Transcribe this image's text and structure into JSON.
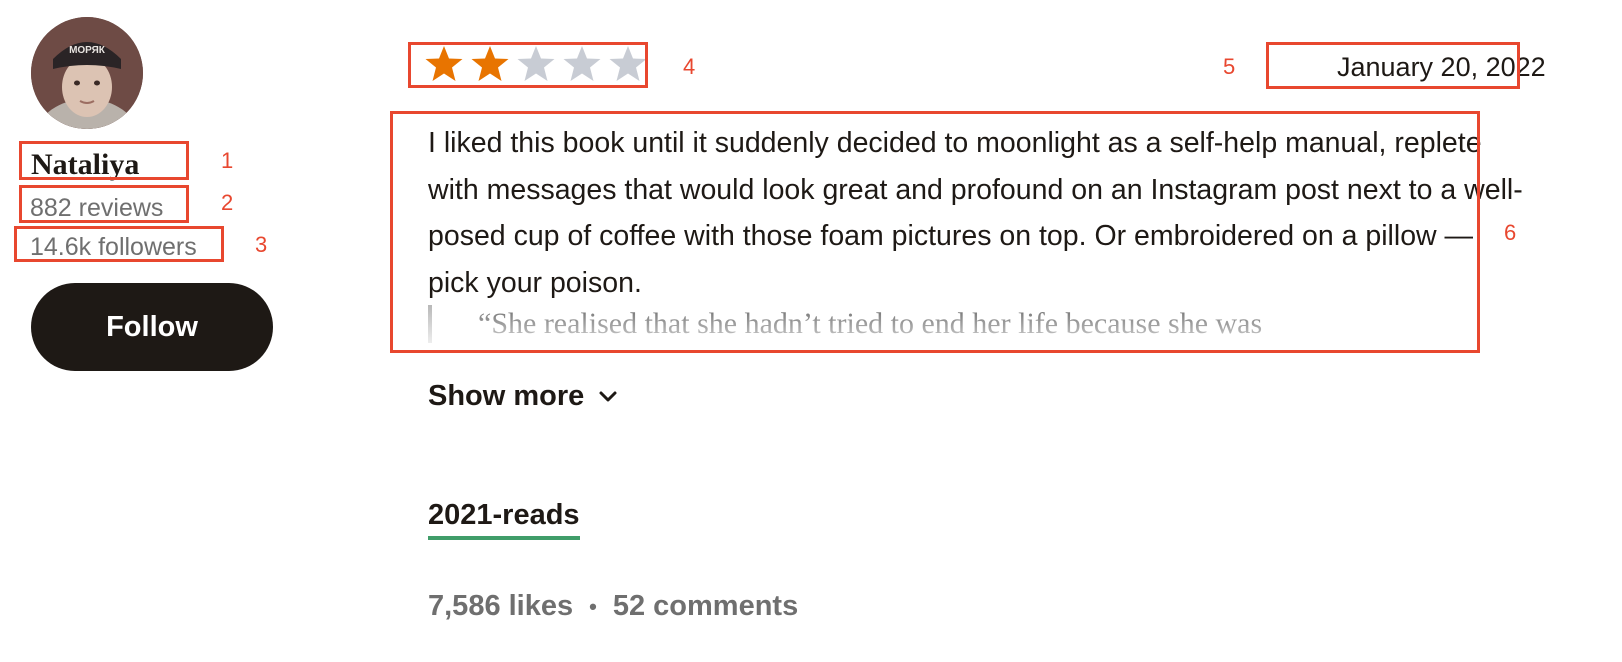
{
  "reviewer": {
    "name": "Nataliya",
    "reviews": "882 reviews",
    "followers": "14.6k followers",
    "follow_label": "Follow",
    "avatar_cap_text": "МОРЯК"
  },
  "review": {
    "rating": 2,
    "max_rating": 5,
    "date": "January 20, 2022",
    "text": "I liked this book until it suddenly decided to moonlight as a self-help manual, replete with messages that would look great and profound on an Instagram post next to a well-posed cup of coffee with those foam pictures on top. Or embroidered on a pillow — pick your poison.",
    "quote": "“She realised that she hadn’t tried to end her life because she was",
    "show_more": "Show more",
    "shelf": "2021-reads",
    "likes": "7,586 likes",
    "separator": "•",
    "comments": "52 comments"
  },
  "annotations": [
    "1",
    "2",
    "3",
    "4",
    "5",
    "6"
  ],
  "colors": {
    "star_filled": "#e87400",
    "star_empty": "#c8ccd4",
    "annotation": "#e8472f",
    "shelf_underline": "#409d69",
    "button_bg": "#1e1915"
  }
}
